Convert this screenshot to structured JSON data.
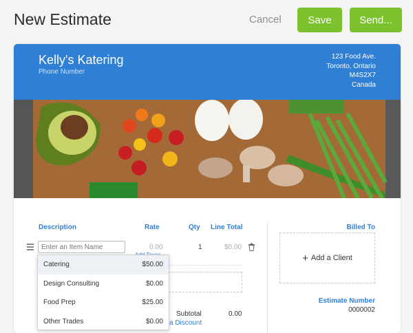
{
  "page": {
    "title": "New Estimate"
  },
  "actions": {
    "cancel": "Cancel",
    "save": "Save",
    "send": "Send..."
  },
  "business": {
    "name": "Kelly's Katering",
    "phone_placeholder": "Phone Number",
    "address": [
      "123 Food Ave.",
      "Toronto, Ontario",
      "M4S2X7",
      "Canada"
    ]
  },
  "colors": {
    "accent": "#2f7fd4",
    "button": "#7dc12f"
  },
  "table": {
    "headers": {
      "description": "Description",
      "rate": "Rate",
      "qty": "Qty",
      "line_total": "Line Total"
    },
    "row": {
      "placeholder": "Enter an Item Name",
      "rate": "0.00",
      "qty": "1",
      "line_total": "$0.00",
      "add_taxes": "Add Taxes"
    },
    "subtotal_label": "Subtotal",
    "subtotal_value": "0.00",
    "add_discount": "a Discount"
  },
  "dropdown": {
    "items": [
      {
        "name": "Catering",
        "price": "$50.00"
      },
      {
        "name": "Design Consulting",
        "price": "$0.00"
      },
      {
        "name": "Food Prep",
        "price": "$25.00"
      },
      {
        "name": "Other Trades",
        "price": "$0.00"
      }
    ]
  },
  "billing": {
    "billed_to": "Billed To",
    "add_client": "Add a Client",
    "estimate_number_label": "Estimate Number",
    "estimate_number": "0000002"
  }
}
